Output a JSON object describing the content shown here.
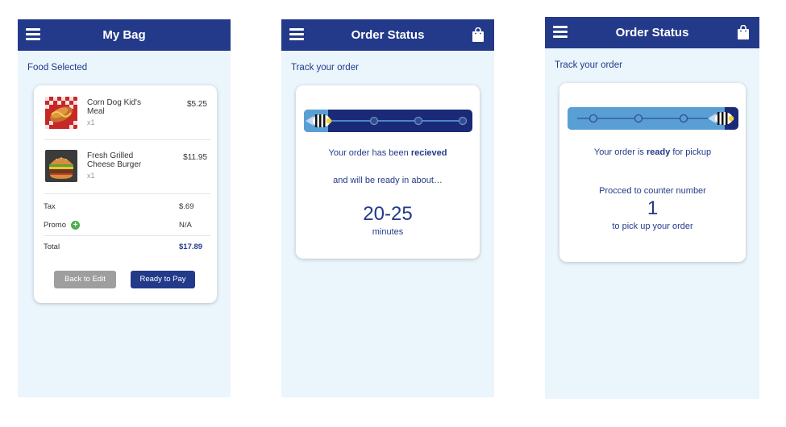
{
  "screens": {
    "bag": {
      "title": "My Bag",
      "section_label": "Food Selected",
      "items": [
        {
          "name": "Corn Dog Kid's Meal",
          "qty": "x1",
          "price": "$5.25"
        },
        {
          "name": "Fresh Grilled Cheese Burger",
          "qty": "x1",
          "price": "$11.95"
        }
      ],
      "tax_label": "Tax",
      "tax_value": "$.69",
      "promo_label": "Promo",
      "promo_value": "N/A",
      "total_label": "Total",
      "total_value": "$17.89",
      "back_button": "Back to Edit",
      "pay_button": "Ready to Pay"
    },
    "status_received": {
      "title": "Order Status",
      "section_label": "Track your order",
      "progress_step": 0,
      "msg_prefix": "Your order has been ",
      "msg_bold": "recieved",
      "msg_line2": "and will be ready in about…",
      "time_range": "20-25",
      "time_unit": "minutes"
    },
    "status_ready": {
      "title": "Order Status",
      "section_label": "Track your order",
      "progress_step": 4,
      "msg_prefix": "Your order is ",
      "msg_bold": "ready",
      "msg_suffix": " for pickup",
      "counter_label": "Procced to counter number",
      "counter_number": "1",
      "pickup_text": "to pick up your order"
    }
  },
  "colors": {
    "header": "#233a8a",
    "background": "#eaf5fc",
    "accent_fill": "#5a9fd4",
    "promo_green": "#4caf50",
    "back_button": "#9e9e9e"
  },
  "icons": [
    "menu-icon",
    "shopping-bag-icon",
    "plus-icon",
    "fish-icon"
  ]
}
